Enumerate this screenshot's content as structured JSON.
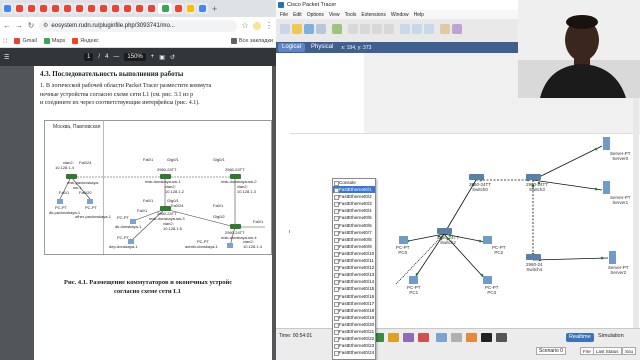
{
  "browser": {
    "tab_colors": [
      "#4285f4",
      "#ea4335",
      "#ea4335",
      "#ea4335",
      "#ea4335",
      "#ea4335",
      "#ea4335",
      "#ea4335",
      "#ea4335",
      "#ea4335",
      "#ea4335",
      "#ea4335",
      "#ea4335",
      "#34a853",
      "#ea4335",
      "#fbbc04",
      "#4285f4"
    ],
    "url": "eosystem.rudn.ru/pluginfile.php/3093741/mo...",
    "bookmarks": [
      {
        "label": "Gmail",
        "color": "#ea4335"
      },
      {
        "label": "Maps",
        "color": "#34a853"
      },
      {
        "label": "Яндекс",
        "color": "#fc3f1d"
      }
    ],
    "all_bookmarks": "Все закладки",
    "pdf": {
      "page": "1",
      "pages": "4",
      "zoom": "150%"
    }
  },
  "document": {
    "heading": "4.3.  Последовательность выполнения работы",
    "para": [
      "1. В логической рабочей области Packet Tracer разместите коммута",
      "    нечные устройства согласно схеме сети L1 (см. рис. 3.1 из р",
      "    и соедините их через соответствующие интерфейсы (рис. 4.1)."
    ],
    "figure_area": "Москва, Павловская",
    "figure_labels": {
      "l1": "vlan2:",
      "l2": "10.128.1.4",
      "l3": "Fa0/24",
      "l4": "msk-pavlovskaya-",
      "l5": "sw-1",
      "l6": "Fa0/1",
      "l7": "Fa0/20",
      "l8": "PC-PT",
      "l9": "dk-pavlovskaya-1",
      "l10": "PC-PT",
      "l11": "other-pavlovskaya-1",
      "m1": "Fa0/1",
      "m2": "Gig0/1",
      "m3": "Gig0/1",
      "m4": "2960-24TT",
      "m5": "2960-24TT",
      "m6": "msk-donskaya-sw-1",
      "m7": "msk-donskaya-sw-2",
      "m8": "vlan2:",
      "m9": "10.128.1.2",
      "m10": "vlan2:",
      "m11": "10.128.1.3",
      "m12": "Fa0/1",
      "m13": "Gig0/1",
      "m14": "Fa0/24",
      "m15": "Fa0/1",
      "m16": "2960-24TT",
      "m17": "msk-donskaya-sw-3",
      "m18": "PC-PT",
      "m19": "dk-donskaya-1",
      "m20": "PC-PT",
      "m21": "dep-donskaya-1",
      "m22": "vlan2:",
      "m23": "10.128.1.5",
      "m24": "Gig0/2",
      "m25": "2960-24TT",
      "m26": "msk-donskaya-sw-4",
      "m27": "vlan2:",
      "m28": "10.128.1.4",
      "m29": "PC-PT",
      "m30": "admin-donskaya-1",
      "m31": "Fa0/1",
      "m32": "Fa0/1"
    },
    "caption": [
      "Рис. 4.1. Размещение коммутаторов и оконечных устройс",
      "согласно схеме сети L1"
    ]
  },
  "packet_tracer": {
    "title": "Cisco Packet Tracer",
    "menu": [
      "File",
      "Edit",
      "Options",
      "View",
      "Tools",
      "Extensions",
      "Window",
      "Help"
    ],
    "tab_logical": "Logical",
    "tab_physical": "Physical",
    "coords": "x: 194, y: 373",
    "time": "Time: 00:54:01",
    "realtime": "Realtime",
    "simulation": "Simulation",
    "scenario": "Scenario 0",
    "fire": "Fire",
    "last_status": "Last Status",
    "source": "Sou",
    "devices": {
      "sw_left": "2960\nSwitch",
      "sw0": "2960-24TT\nSwitch0",
      "sw2": "2960-24TT\nSwitch2",
      "sw3": "2960-24TT\nSwitch3",
      "sw4": "2960-24\nSwitch4",
      "pc0": "PC-PT\nPC0",
      "pc1": "PC-PT\nPC1",
      "pc2": "PC-PT\nPC2",
      "pc3": "PC-PT\nPC3",
      "pc_left": "PC-PT\nPC0",
      "srv0": "Server-PT\nServer0",
      "srv1": "Server-PT\nServer1",
      "srv2": "Server-PT\nServer2"
    },
    "port_menu": [
      "Console",
      "FastEthernet0/1",
      "FastEthernet0/2",
      "FastEthernet0/3",
      "FastEthernet0/4",
      "FastEthernet0/5",
      "FastEthernet0/6",
      "FastEthernet0/7",
      "FastEthernet0/8",
      "FastEthernet0/9",
      "FastEthernet0/10",
      "FastEthernet0/11",
      "FastEthernet0/12",
      "FastEthernet0/13",
      "FastEthernet0/14",
      "FastEthernet0/15",
      "FastEthernet0/16",
      "FastEthernet0/17",
      "FastEthernet0/18",
      "FastEthernet0/19",
      "FastEthernet0/20",
      "FastEthernet0/21",
      "FastEthernet0/22",
      "FastEthernet0/23",
      "FastEthernet0/24"
    ],
    "port_menu_highlight": 1
  }
}
